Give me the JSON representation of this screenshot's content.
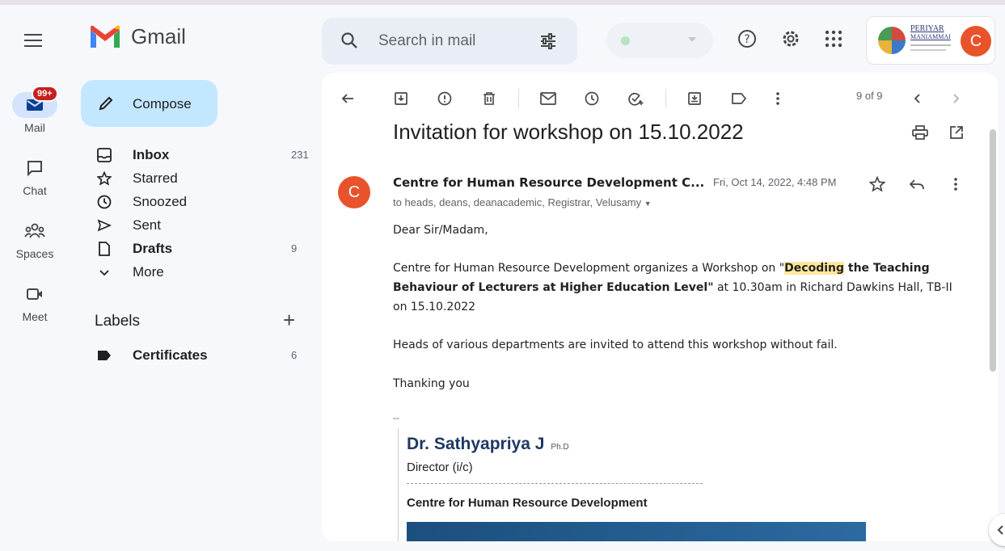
{
  "app": {
    "logo_text": "Gmail",
    "search_placeholder": "Search in mail"
  },
  "rail": {
    "mail_label": "Mail",
    "mail_badge": "99+",
    "chat_label": "Chat",
    "spaces_label": "Spaces",
    "meet_label": "Meet"
  },
  "compose_label": "Compose",
  "nav": [
    {
      "label": "Inbox",
      "count": "231",
      "bold": true,
      "icon": "inbox-icon"
    },
    {
      "label": "Starred",
      "count": "",
      "bold": false,
      "icon": "star-icon"
    },
    {
      "label": "Snoozed",
      "count": "",
      "bold": false,
      "icon": "clock-icon"
    },
    {
      "label": "Sent",
      "count": "",
      "bold": false,
      "icon": "send-icon"
    },
    {
      "label": "Drafts",
      "count": "9",
      "bold": true,
      "icon": "draft-icon"
    },
    {
      "label": "More",
      "count": "",
      "bold": false,
      "icon": "chevron-down-icon"
    }
  ],
  "labels": {
    "heading": "Labels",
    "items": [
      {
        "label": "Certificates",
        "count": "6",
        "icon": "label-icon"
      }
    ]
  },
  "account": {
    "org_name_line1": "PERIYAR",
    "org_name_line2": "MANIAMMAI",
    "avatar_letter": "C",
    "avatar_color": "#e8532b"
  },
  "toolbar": {
    "pager": "9 of 9"
  },
  "email": {
    "subject": "Invitation for workshop on 15.10.2022",
    "sender_initial": "C",
    "sender": "Centre for Human Resource Development C...",
    "date": "Fri, Oct 14, 2022, 4:48 PM",
    "to": "to heads, deans, deanacademic, Registrar, Velusamy",
    "greeting": "Dear Sir/Madam,",
    "p1_a": "Centre for Human Resource Development organizes a Workshop on ",
    "p1_q": "\"",
    "p1_highlight": "Decoding",
    "p1_bold": " the Teaching Behaviour of Lecturers at Higher Education Level\"",
    "p1_c": " at 10.30am in Richard Dawkins Hall, TB-II on 15.10.2022",
    "p2": "Heads of various departments are invited to attend this workshop without fail.",
    "p3": "Thanking you",
    "sig_dash": "--",
    "sig_name": "Dr. Sathyapriya J",
    "sig_degree": "Ph.D",
    "sig_role": "Director (i/c)",
    "sig_org": "Centre for Human Resource Development"
  },
  "colors": {
    "accent_blue": "#c2e7ff",
    "active_rail": "#d3e3fd",
    "highlight": "#ffe99a",
    "badge_red": "#c5221f"
  }
}
